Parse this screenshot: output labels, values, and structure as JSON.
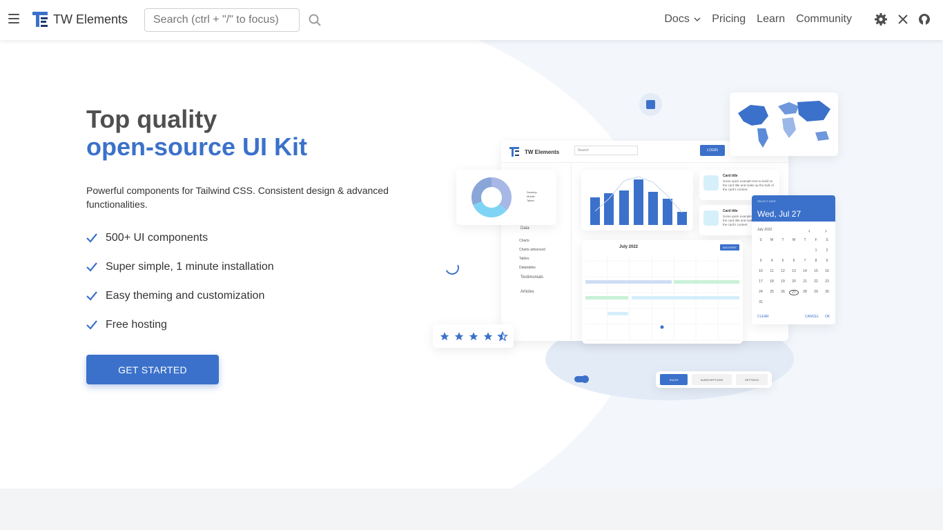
{
  "nav": {
    "brand": "TW Elements",
    "search_placeholder": "Search (ctrl + \"/\" to focus)",
    "links": {
      "docs": "Docs",
      "pricing": "Pricing",
      "learn": "Learn",
      "community": "Community"
    }
  },
  "hero": {
    "title_line1": "Top quality",
    "title_line2": "open-source UI Kit",
    "lead": "Powerful components for Tailwind CSS. Consistent design & advanced functionalities.",
    "features": [
      "500+ UI components",
      "Super simple, 1 minute installation",
      "Easy theming and customization",
      "Free hosting"
    ],
    "cta": "GET STARTED"
  },
  "illustration": {
    "dash_brand": "TW Elements",
    "search": "Search",
    "login": "LOGIN",
    "sidebar": [
      "Data",
      "Charts",
      "Charts advanced",
      "Tables",
      "Datatables",
      "Testimonials",
      "Articles"
    ],
    "card_title": "Card title",
    "card_text": "Some quick example text to build on the card title and make up the bulk of the card's content.",
    "calendar_month": "July 2022",
    "add_event": "ADD EVENT",
    "dp_label": "SELECT DATE",
    "dp_value": "Wed, Jul 27",
    "dp_month": "July 2022",
    "dp_weekdays": [
      "S",
      "M",
      "T",
      "W",
      "T",
      "F",
      "S"
    ],
    "dp_days": [
      "1",
      "2",
      "3",
      "4",
      "5",
      "6",
      "7",
      "8",
      "9",
      "10",
      "11",
      "12",
      "13",
      "14",
      "15",
      "16",
      "17",
      "18",
      "19",
      "20",
      "21",
      "22",
      "23",
      "24",
      "25",
      "26",
      "27",
      "28",
      "29",
      "30",
      "31"
    ],
    "dp_clear": "CLEAR",
    "dp_cancel": "CANCEL",
    "dp_ok": "OK",
    "tabs": [
      "SALES",
      "SUBSCRIPTIONS",
      "SETTINGS"
    ],
    "donut_legend": [
      "Desktop",
      "Mobile",
      "Tablet"
    ]
  },
  "colors": {
    "primary": "#3b71ca",
    "text": "#4f4f4f",
    "hero_bg": "#f3f7fc"
  }
}
